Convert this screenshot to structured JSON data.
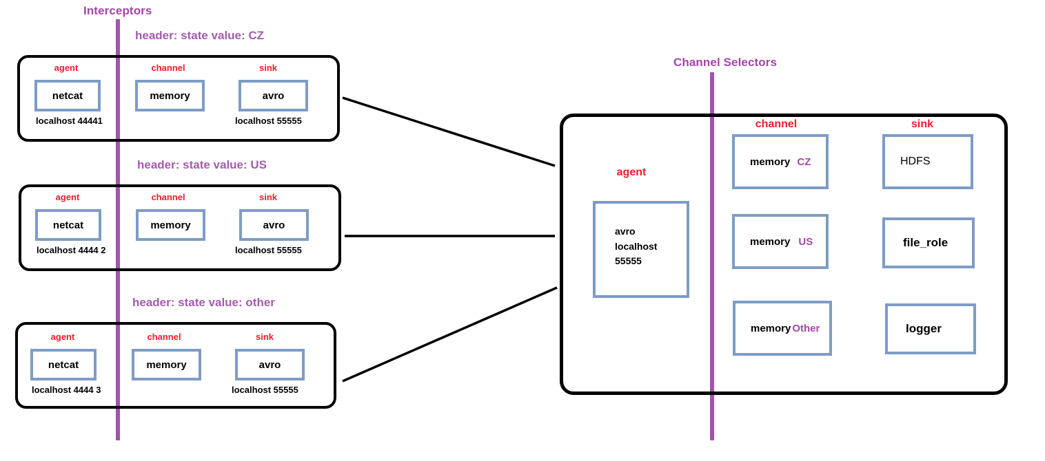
{
  "titles": {
    "interceptors": "Interceptors",
    "channel_selectors": "Channel Selectors"
  },
  "colors": {
    "purple": "#A345A8",
    "purple_line": "#A452B0",
    "red": "#EE1B2E",
    "blue_border": "#7E9CC4",
    "black": "#000000"
  },
  "source_agents": [
    {
      "header": "header: state value: CZ",
      "columns": {
        "agent_label": "agent",
        "channel_label": "channel",
        "sink_label": "sink"
      },
      "source": {
        "name": "netcat",
        "host": "localhost 44441"
      },
      "channel": {
        "name": "memory"
      },
      "sink": {
        "name": "avro",
        "host": "localhost 55555"
      }
    },
    {
      "header": "header: state value: US",
      "columns": {
        "agent_label": "agent",
        "channel_label": "channel",
        "sink_label": "sink"
      },
      "source": {
        "name": "netcat",
        "host": "localhost 4444 2"
      },
      "channel": {
        "name": "memory"
      },
      "sink": {
        "name": "avro",
        "host": "localhost 55555"
      }
    },
    {
      "header": "header: state value: other",
      "columns": {
        "agent_label": "agent",
        "channel_label": "channel",
        "sink_label": "sink"
      },
      "source": {
        "name": "netcat",
        "host": "localhost 4444 3"
      },
      "channel": {
        "name": "memory"
      },
      "sink": {
        "name": "avro",
        "host": "localhost 55555"
      }
    }
  ],
  "collector": {
    "agent_label": "agent",
    "channel_label": "channel",
    "sink_label": "sink",
    "source": {
      "line1": "avro",
      "line2": "localhost",
      "line3": "55555"
    },
    "channels": [
      {
        "name": "memory",
        "tag": "CZ"
      },
      {
        "name": "memory",
        "tag": "US"
      },
      {
        "name": "memory",
        "tag": "Other"
      }
    ],
    "sinks": [
      {
        "name": "HDFS"
      },
      {
        "name": "file_role"
      },
      {
        "name": "logger"
      }
    ]
  }
}
